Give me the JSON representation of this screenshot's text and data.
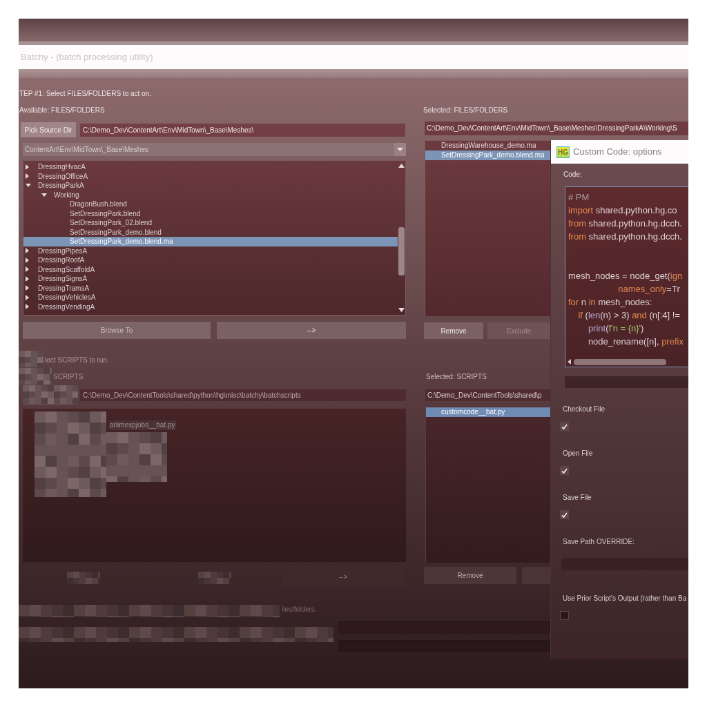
{
  "window": {
    "title": "Batchy - (batch processing utility)"
  },
  "step1": {
    "heading": "TEP #1: Select FILES/FOLDERS to act on.",
    "available": {
      "label": "Available: FILES/FOLDERS",
      "pick_button": "Pick Source Dir",
      "source_dir": "C:\\Demo_Dev\\ContentArt\\Env\\MidTown\\_Base\\Meshes\\",
      "combo_value": "ContentArt\\Env\\MidTown\\_Base\\Meshes",
      "tree": [
        {
          "label": "DressingHvacA",
          "expanded": false,
          "selected": false
        },
        {
          "label": "DressingOfficeA",
          "expanded": false,
          "selected": false
        },
        {
          "label": "DressingParkA",
          "expanded": true,
          "selected": false,
          "children": [
            {
              "label": "Working",
              "expanded": true,
              "selected": false,
              "children": [
                {
                  "label": "DragonBush.blend",
                  "selected": false
                },
                {
                  "label": "SetDressingPark.blend",
                  "selected": false
                },
                {
                  "label": "SetDressingPark_02.blend",
                  "selected": false
                },
                {
                  "label": "SetDressingPark_demo.blend",
                  "selected": false
                },
                {
                  "label": "SetDressingPark_demo.blend.ma",
                  "selected": true
                }
              ]
            }
          ]
        },
        {
          "label": "DressingPipesA",
          "expanded": false,
          "selected": false
        },
        {
          "label": "DressingRoofA",
          "expanded": false,
          "selected": false
        },
        {
          "label": "DressingScaffoldA",
          "expanded": false,
          "selected": false
        },
        {
          "label": "DressingSignsA",
          "expanded": false,
          "selected": false
        },
        {
          "label": "DressingTramsA",
          "expanded": false,
          "selected": false
        },
        {
          "label": "DressingVehiclesA",
          "expanded": false,
          "selected": false
        },
        {
          "label": "DressingVendingA",
          "expanded": false,
          "selected": false
        }
      ],
      "buttons": [
        "Browse To",
        "-->"
      ]
    },
    "selected": {
      "label": "Selected: FILES/FOLDERS",
      "path": "C:\\Demo_Dev\\ContentArt\\Env\\MidTown\\_Base\\Meshes\\DressingParkA\\Working\\S",
      "items": [
        {
          "label": "DressingWarehouse_demo.ma",
          "selected": false
        },
        {
          "label": "SetDressingPark_demo.blend.ma",
          "selected": true
        }
      ],
      "buttons": [
        {
          "label": "Remove",
          "disabled": false
        },
        {
          "label": "Exclude",
          "disabled": true
        }
      ]
    }
  },
  "step2": {
    "heading": "lect SCRIPTS to run.",
    "available": {
      "label": "SCRIPTS",
      "path": "C:\\Demo_Dev\\ContentTools\\shared\\python\\hg\\misc\\batchy\\batchscripts",
      "items": [
        {
          "label": "animexpjobs__bat.py",
          "selected": false
        }
      ],
      "buttons": [
        "-->"
      ]
    },
    "selected": {
      "label": "Selected: SCRIPTS",
      "path": "C:\\Demo_Dev\\ContentTools\\shared\\p",
      "items": [
        {
          "label": "customcode__bat.py",
          "selected": true
        }
      ],
      "buttons": [
        "Remove"
      ]
    }
  },
  "footer": {
    "note": "iles/folders."
  },
  "dialog": {
    "logo": "HG",
    "title": "Custom Code: options",
    "code_label": "Code:",
    "code_lines": [
      {
        "kind": "code",
        "segments": [
          {
            "text": "# PM",
            "kind": "comment"
          }
        ]
      },
      {
        "kind": "code",
        "segments": [
          {
            "text": "import",
            "kind": "keyword"
          },
          {
            "text": " shared.python.hg.co",
            "kind": "plain"
          }
        ]
      },
      {
        "kind": "code",
        "segments": [
          {
            "text": "from",
            "kind": "keyword"
          },
          {
            "text": " shared.python.hg.dcch.",
            "kind": "plain"
          }
        ]
      },
      {
        "kind": "code",
        "segments": [
          {
            "text": "from",
            "kind": "keyword"
          },
          {
            "text": " shared.python.hg.dcch.",
            "kind": "plain"
          }
        ]
      },
      {
        "kind": "blank"
      },
      {
        "kind": "blank"
      },
      {
        "kind": "code",
        "segments": [
          {
            "text": "mesh_nodes = node_get(",
            "kind": "plain"
          },
          {
            "text": "ign",
            "kind": "param"
          }
        ]
      },
      {
        "kind": "code",
        "segments": [
          {
            "text": "                    names_only",
            "kind": "param"
          },
          {
            "text": "=Tr",
            "kind": "plain"
          }
        ]
      },
      {
        "kind": "code",
        "segments": [
          {
            "text": "for",
            "kind": "keyword"
          },
          {
            "text": " n ",
            "kind": "plain"
          },
          {
            "text": "in",
            "kind": "keyword"
          },
          {
            "text": " mesh_nodes:",
            "kind": "plain"
          }
        ]
      },
      {
        "kind": "code",
        "segments": [
          {
            "text": "    if",
            "kind": "keyword"
          },
          {
            "text": " (",
            "kind": "plain"
          },
          {
            "text": "len",
            "kind": "builtin"
          },
          {
            "text": "(n) > 3) ",
            "kind": "plain"
          },
          {
            "text": "and",
            "kind": "keyword"
          },
          {
            "text": " (n[:4] !=",
            "kind": "plain"
          }
        ]
      },
      {
        "kind": "code",
        "segments": [
          {
            "text": "        print",
            "kind": "builtin"
          },
          {
            "text": "(",
            "kind": "plain"
          },
          {
            "text": "f'n = {n}'",
            "kind": "string"
          },
          {
            "text": ")",
            "kind": "plain"
          }
        ]
      },
      {
        "kind": "code",
        "segments": [
          {
            "text": "        node_rename([n], ",
            "kind": "plain"
          },
          {
            "text": "prefix",
            "kind": "param"
          }
        ]
      }
    ],
    "options": [
      {
        "kind": "checkbox",
        "label": "Checkout File",
        "checked": true
      },
      {
        "kind": "checkbox",
        "label": "Open File",
        "checked": true
      },
      {
        "kind": "checkbox",
        "label": "Save File",
        "checked": true
      },
      {
        "kind": "field",
        "label": "Save Path OVERRIDE:"
      },
      {
        "kind": "checkbox",
        "label": "Use Prior Script's Output (rather than Ba",
        "checked": false
      }
    ]
  }
}
